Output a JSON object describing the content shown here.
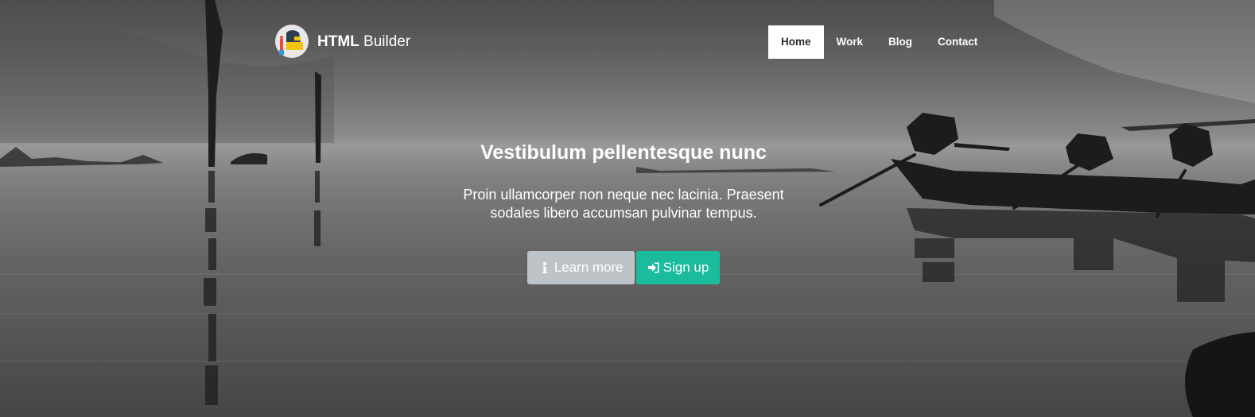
{
  "brand": {
    "bold": "HTML",
    "light": " Builder",
    "logo_icon": "builder-mascot-icon"
  },
  "nav": {
    "items": [
      {
        "label": "Home",
        "active": true
      },
      {
        "label": "Work",
        "active": false
      },
      {
        "label": "Blog",
        "active": false
      },
      {
        "label": "Contact",
        "active": false
      }
    ]
  },
  "hero": {
    "headline": "Vestibulum pellentesque nunc",
    "lede": "Proin ullamcorper non neque nec lacinia. Praesent sodales libero accumsan pulvinar tempus.",
    "buttons": {
      "learn_more": {
        "label": "Learn more",
        "icon": "info-icon",
        "color": "#bdc3c7"
      },
      "sign_up": {
        "label": "Sign up",
        "icon": "sign-in-icon",
        "color": "#1abc9c"
      }
    }
  }
}
